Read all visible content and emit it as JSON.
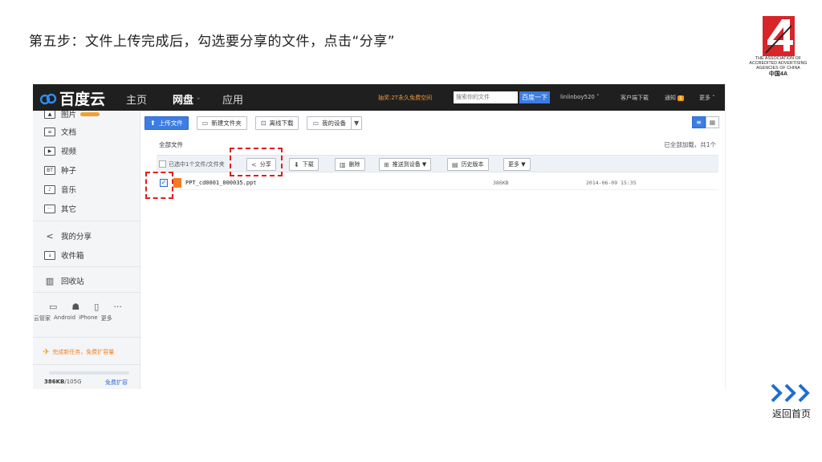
{
  "slide": {
    "title": "第五步：文件上传完成后，勾选要分享的文件，点击“分享”",
    "return_label": "返回首页"
  },
  "logo": {
    "line1": "THE ASSOCIATION OF",
    "line2": "ACCREDITED ADVERTISING",
    "line3": "AGENCIES OF CHINA",
    "line4": "中国4A",
    "color": "#d7252a"
  },
  "topbar": {
    "brand": "百度云",
    "nav": [
      "主页",
      "网盘",
      "应用"
    ],
    "active_chevron": "˅",
    "promo": "抽奖:2T永久免费空间",
    "search_placeholder": "搜索你的文件",
    "search_button": "百度一下",
    "username": "linlinboy520 ˅",
    "client_download": "客户端下载",
    "notice": "通知",
    "notice_count": "1",
    "more": "更多 ˅"
  },
  "sidebar": {
    "items": [
      {
        "label": "图片",
        "icon": "image-icon"
      },
      {
        "label": "文档",
        "icon": "document-icon"
      },
      {
        "label": "视频",
        "icon": "video-icon"
      },
      {
        "label": "种子",
        "icon": "torrent-icon"
      },
      {
        "label": "音乐",
        "icon": "music-icon"
      },
      {
        "label": "其它",
        "icon": "other-icon"
      },
      {
        "label": "我的分享",
        "icon": "share-icon"
      },
      {
        "label": "收件箱",
        "icon": "inbox-icon"
      },
      {
        "label": "回收站",
        "icon": "trash-icon"
      }
    ],
    "device_labels": [
      "云管家",
      "Android",
      "iPhone",
      "更多"
    ],
    "task_promo": "完成新任务，免费扩容量",
    "quota_used": "386KB",
    "quota_total": "/105G",
    "quota_link": "免费扩容"
  },
  "toolbar": {
    "upload": "上传文件",
    "new_folder": "新建文件夹",
    "offline_download": "离线下载",
    "my_devices": "我的设备"
  },
  "list": {
    "breadcrumb": "全部文件",
    "count": "已全部加载，共1个",
    "selected_text": "已选中1个文件/文件夹",
    "actions": {
      "share": "分享",
      "download": "下载",
      "delete": "删除",
      "push": "推送到设备 ▼",
      "history": "历史版本",
      "more": "更多 ▼"
    },
    "files": [
      {
        "name": "PPT_cd0001_000035.ppt",
        "size": "386KB",
        "date": "2014-06-09 15:35"
      }
    ]
  },
  "colors": {
    "highlight": "#e01e1e",
    "primary": "#3b7de3",
    "topbar": "#1f1f1f"
  }
}
